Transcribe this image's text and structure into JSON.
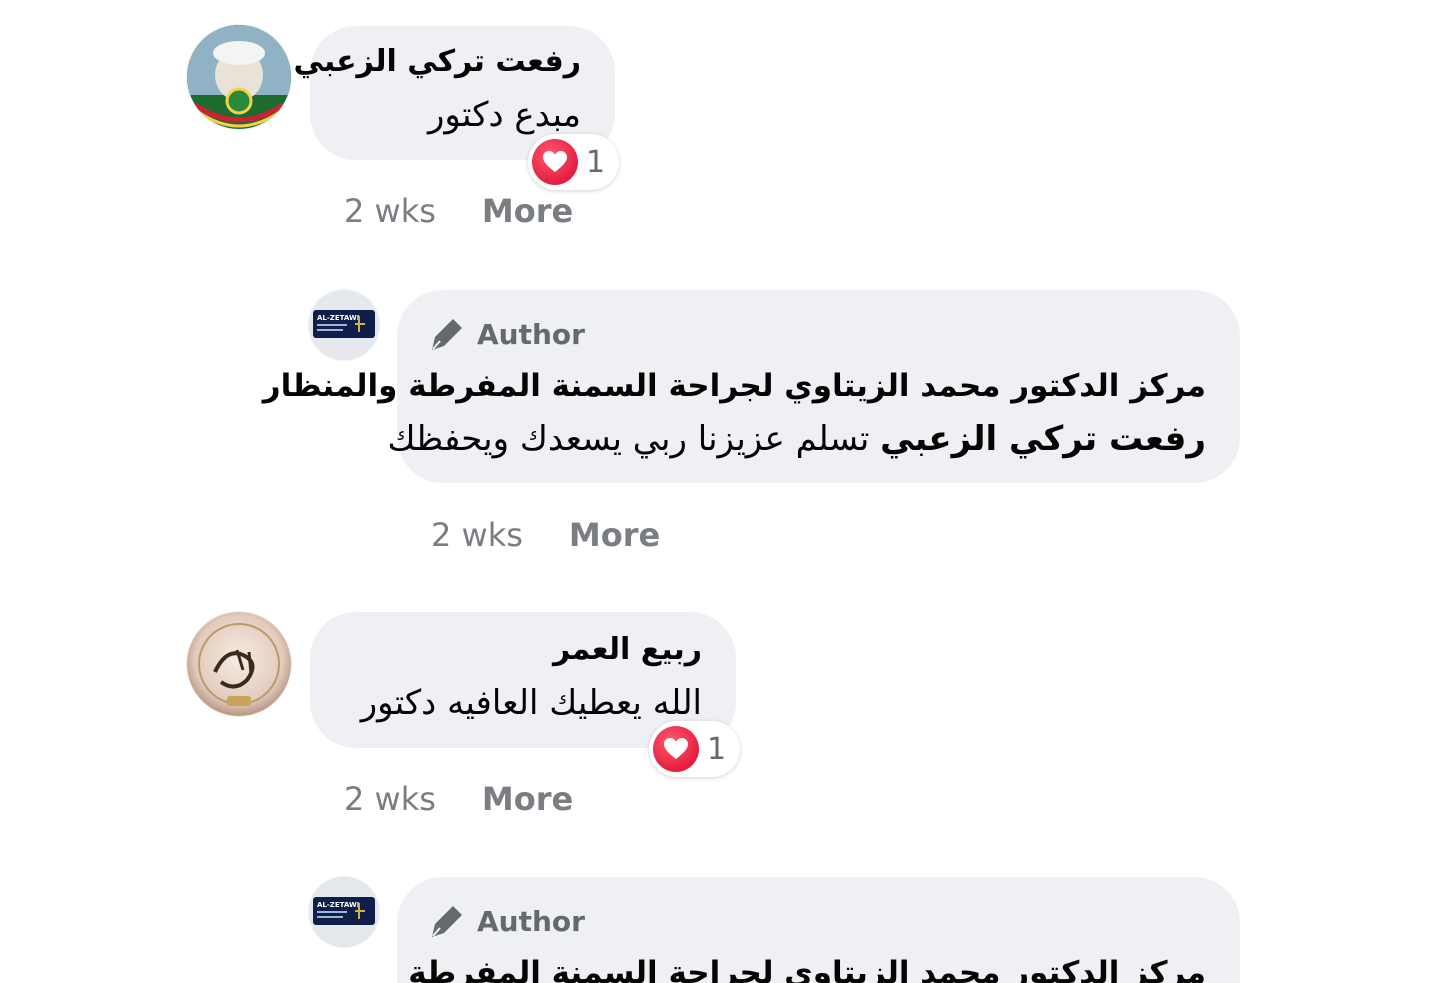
{
  "comments": [
    {
      "name": "رفعت تركي الزعبي",
      "text": "مبدع دكتور",
      "reaction_count": "1",
      "time": "2 wks",
      "more": "More"
    },
    {
      "author_badge": "Author",
      "name": "مركز الدكتور محمد الزيتاوي لجراحة السمنة المفرطة والمنظار",
      "mention": "رفعت تركي الزعبي",
      "text": "تسلم عزيزنا ربي يسعدك ويحفظك",
      "time": "2 wks",
      "more": "More"
    },
    {
      "name": "ربيع العمر",
      "text": "الله يعطيك العافيه دكتور",
      "reaction_count": "1",
      "time": "2 wks",
      "more": "More"
    },
    {
      "author_badge": "Author",
      "name": "مركز الدكتور محمد الزيتاوي لجراحة السمنة المفرطة والمنظار"
    }
  ],
  "logo_text": "AL-ZETAWI",
  "colors": {
    "bubble": "#eef0f3",
    "meta_text": "#7a7d82",
    "author_text": "#65686c",
    "heart": "#e41e3f"
  },
  "icons": {
    "author": "pen-icon",
    "reaction": "heart-icon"
  }
}
